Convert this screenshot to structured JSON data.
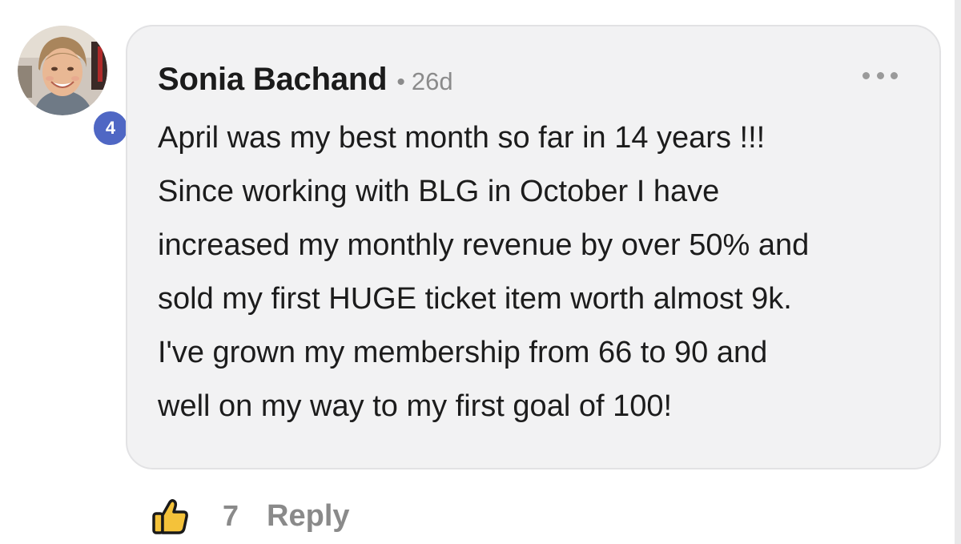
{
  "comment": {
    "author": "Sonia Bachand",
    "separator": "•",
    "age": "26d",
    "level": "4",
    "body_lines": [
      "April was my best month so far in 14 years !!!",
      "Since working with BLG in October I have",
      "increased my monthly revenue by over 50% and",
      "sold my first HUGE ticket item worth almost 9k.",
      "I've grown my membership from 66 to 90 and",
      "well on my way to my first goal of 100!"
    ]
  },
  "actions": {
    "like_icon": "thumbs-up-icon",
    "like_count": "7",
    "reply_label": "Reply",
    "more_icon": "more-options-icon"
  },
  "colors": {
    "bubble_background": "#f2f2f3",
    "level_badge": "#4f67c4",
    "like_icon_fill": "#f4c23a",
    "muted_text": "#8a8a8a"
  }
}
